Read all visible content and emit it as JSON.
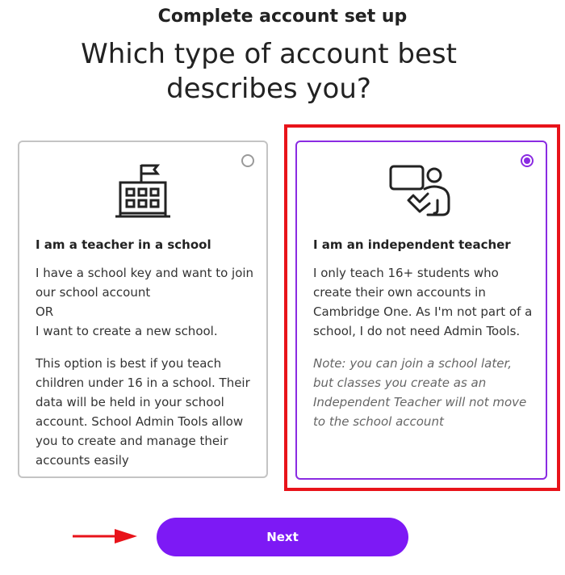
{
  "header": {
    "step_title": "Complete account set up",
    "question": "Which type of account best describes you?"
  },
  "options": [
    {
      "id": "school",
      "selected": false,
      "icon": "school-building-icon",
      "title": "I am a teacher in a school",
      "body_lines": [
        "I have a school key and want to join our school account",
        "OR",
        "I want to create a new school."
      ],
      "extra": "This option is best if you teach children under 16 in a school. Their data will be held in your school account. School Admin Tools allow you to create and manage their accounts easily"
    },
    {
      "id": "independent",
      "selected": true,
      "icon": "independent-teacher-icon",
      "title": "I am an independent teacher",
      "body": "I only teach 16+ students who create their own accounts in Cambridge One. As I'm not part of a school, I do not need Admin Tools.",
      "note": "Note: you can join a school later, but classes you create as an Independent Teacher will not move to the school account"
    }
  ],
  "actions": {
    "next_label": "Next"
  },
  "colors": {
    "accent": "#8a2be2",
    "button": "#7d19f5",
    "annotation": "#e8131a"
  }
}
